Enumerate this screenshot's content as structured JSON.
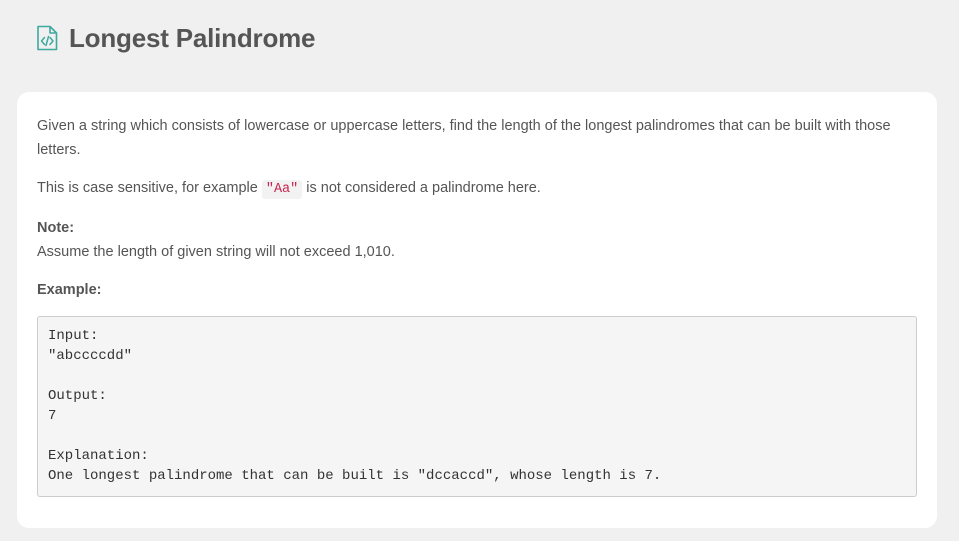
{
  "header": {
    "icon": "code-document-icon",
    "title": "Longest Palindrome"
  },
  "problem": {
    "description": "Given a string which consists of lowercase or uppercase letters, find the length of the longest palindromes that can be built with those letters.",
    "case_sensitive_before": "This is case sensitive, for example ",
    "case_sensitive_code": "\"Aa\"",
    "case_sensitive_after": " is not considered a palindrome here.",
    "note_label": "Note:",
    "note_text": "Assume the length of given string will not exceed 1,010.",
    "example_label": "Example:",
    "example_lines": [
      "Input:",
      "\"abccccdd\"",
      "",
      "Output:",
      "7",
      "",
      "Explanation:",
      "One longest palindrome that can be built is \"dccaccd\", whose length is 7."
    ]
  },
  "colors": {
    "background": "#f0f0f0",
    "card": "#ffffff",
    "text": "#555555",
    "icon_accent": "#3ea99f",
    "inline_code": "#c7254e"
  }
}
